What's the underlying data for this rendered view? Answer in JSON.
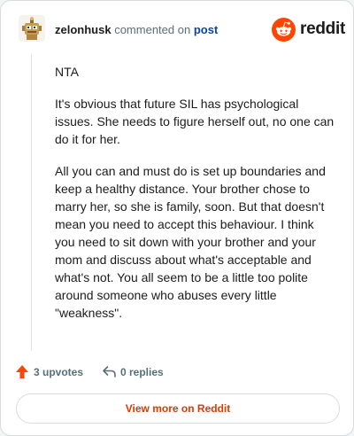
{
  "header": {
    "username": "zelonhusk",
    "commented_text": "commented on",
    "post_link": "post",
    "logo_word": "reddit"
  },
  "comment": {
    "paragraphs": [
      "NTA",
      "It's obvious that future SIL has psychological issues. She needs to figure herself out, no one can do it for her.",
      "All you can and must do is set up boundaries and keep a healthy distance. Your brother chose to marry her, so she is family, soon. But that doesn't mean you need to accept this behaviour. I think you need to sit down with your brother and your mom and discuss about what's acceptable and what's not. You all seem to be a little too polite around someone who abuses every little \"weakness\"."
    ]
  },
  "actions": {
    "upvotes": "3 upvotes",
    "replies": "0 replies"
  },
  "footer": {
    "view_more": "View more on Reddit"
  },
  "colors": {
    "upvote": "#ff4500",
    "link": "#0a449b",
    "view_more": "#d93a00",
    "reddit_orange": "#ff4500"
  }
}
